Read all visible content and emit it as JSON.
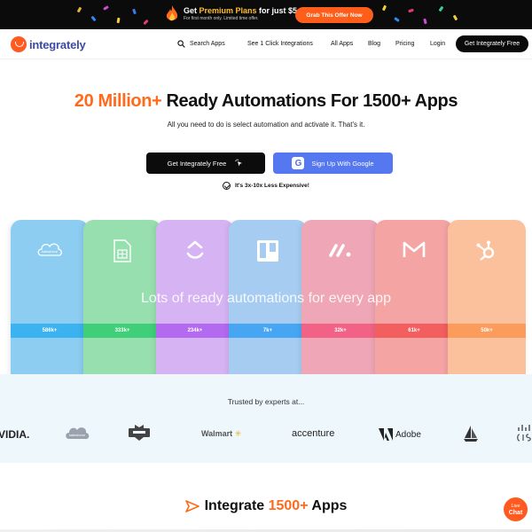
{
  "promo": {
    "text_prefix": "Get ",
    "text_highlight": "Premium Plans",
    "text_suffix": " for just $5",
    "subtext": "For first month only. Limited time offer.",
    "button_label": "Grab This Offer Now"
  },
  "nav": {
    "logo_text": "integrately",
    "search_label": "Search Apps",
    "items": [
      "See 1 Click Integrations",
      "All Apps",
      "Blog",
      "Pricing",
      "Login"
    ],
    "cta_label": "Get Integrately Free"
  },
  "hero": {
    "title_accent": "20 Million+",
    "title_rest": " Ready Automations For 1500+ Apps",
    "subtitle": "All you need to do is select automation and activate it. That's it.",
    "primary_button": "Get Integrately Free",
    "google_button": "Sign Up With Google",
    "google_glyph": "G",
    "cheaper_note": "It's 3x-10x Less Expensive!"
  },
  "cards": {
    "caption": "Lots of ready automations for every app",
    "items": [
      {
        "icon": "salesforce-icon",
        "icon_text": "salesforce",
        "count": "586k+",
        "bg": "#8dcdf1",
        "band": "#3bb3f0"
      },
      {
        "icon": "google-sheets-icon",
        "count": "333k+",
        "bg": "#97dfaf",
        "band": "#3fcf79"
      },
      {
        "icon": "clickup-icon",
        "count": "234k+",
        "bg": "#d6b4f3",
        "band": "#b46af0"
      },
      {
        "icon": "trello-icon",
        "count": "7k+",
        "bg": "#a6cdf1",
        "band": "#47a6f3"
      },
      {
        "icon": "monday-icon",
        "count": "32k+",
        "bg": "#efa6b6",
        "band": "#f26286"
      },
      {
        "icon": "gmail-icon",
        "count": "61k+",
        "bg": "#f5a4a4",
        "band": "#f35e5e"
      },
      {
        "icon": "hubspot-icon",
        "count": "50k+",
        "bg": "#fbc19c",
        "band": "#fb9b5c"
      }
    ]
  },
  "trusted": {
    "title": "Trusted by experts at...",
    "brands": [
      "VIDIA.",
      "salesforce",
      "Walmart",
      "accenture",
      "Adobe"
    ]
  },
  "integrate": {
    "title_prefix": "Integrate ",
    "title_accent": "1500+",
    "title_suffix": " Apps"
  },
  "chat": {
    "line1": "Live",
    "line2": "Chat"
  }
}
